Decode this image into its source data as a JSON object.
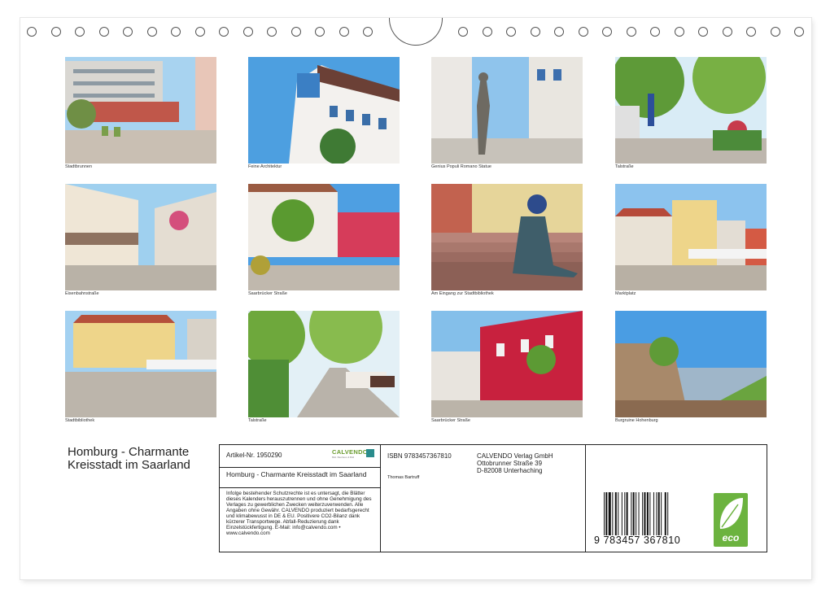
{
  "photos": [
    {
      "caption": "Stadtbrunnen"
    },
    {
      "caption": "Feine Architektur"
    },
    {
      "caption": "Genius Populi Romano Statue"
    },
    {
      "caption": "Talstraße"
    },
    {
      "caption": "Eisenbahnstraße"
    },
    {
      "caption": "Saarbrücker Straße"
    },
    {
      "caption": "Am Eingang zur Stadtbibliothek"
    },
    {
      "caption": "Marktplatz"
    },
    {
      "caption": "Stadtbibliothek"
    },
    {
      "caption": "Talstraße"
    },
    {
      "caption": "Saarbrücker Straße"
    },
    {
      "caption": "Burgruine Hohenburg"
    }
  ],
  "title": "Homburg - Charmante Kreisstadt im Saarland",
  "info": {
    "article": "Artikel-Nr. 1950290",
    "publisher_logo": "CALVENDO",
    "publisher_tagline": "Bild. Bauhaus & Bild",
    "product_title": "Homburg - Charmante Kreisstadt im Saarland",
    "legal_text": "Infolge bestehender Schutzrechte ist es untersagt, die Blätter dieses Kalenders herauszutrennen und ohne Genehmigung des Verlages zu gewerblichen Zwecken weiterzuverwenden. Alle Angaben ohne Gewähr. CALVENDO produziert bedarfsgerecht und klimabewusst in DE & EU. Positivere CO2-Bilanz dank kürzerer Transportwege. Abfall-Reduzierung dank Einzelstückfertigung. E-Mail: info@calvendo.com • www.calvendo.com",
    "isbn": "ISBN 9783457367810",
    "author": "Thomas Bartruff",
    "address_line1": "CALVENDO Verlag GmbH",
    "address_line2": "Ottobrunner Straße 39",
    "address_line3": "D-82008 Unterhaching",
    "barcode_number": "9 783457 367810",
    "eco_label": "eco"
  }
}
